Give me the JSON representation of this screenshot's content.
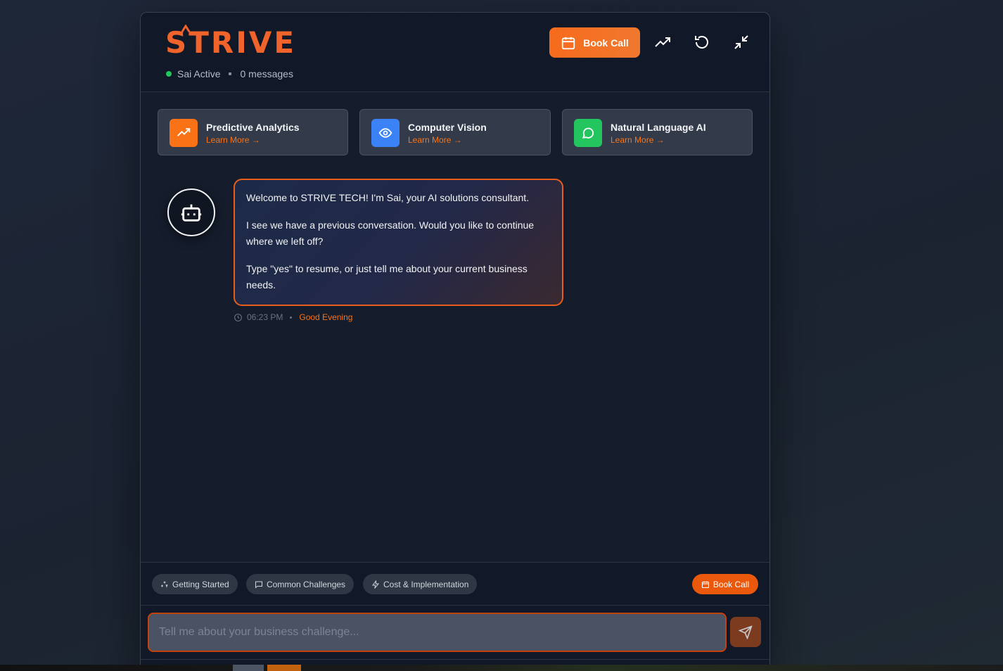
{
  "header": {
    "logo_text": "STRIVE",
    "status_label": "Sai Active",
    "message_count": "0 messages",
    "book_call_label": "Book Call",
    "brand_color": "#f76b1c"
  },
  "services": [
    {
      "title": "Predictive Analytics",
      "link": "Learn More →",
      "icon": "trending-up-icon",
      "color": "#f97316"
    },
    {
      "title": "Computer Vision",
      "link": "Learn More →",
      "icon": "eye-icon",
      "color": "#3b82f6"
    },
    {
      "title": "Natural Language AI",
      "link": "Learn More →",
      "icon": "chat-icon",
      "color": "#22c55e"
    }
  ],
  "message": {
    "paragraphs": [
      "Welcome to STRIVE TECH! I'm Sai, your AI solutions consultant.",
      "I see we have a previous conversation. Would you like to continue where we left off?",
      "Type \"yes\" to resume, or just tell me about your current business needs."
    ],
    "time": "06:23 PM",
    "greeting": "Good Evening"
  },
  "quick_actions": {
    "chips": [
      "Getting Started",
      "Common Challenges",
      "Cost & Implementation"
    ],
    "book_call_label": "Book Call"
  },
  "input": {
    "placeholder": "Tell me about your business challenge...",
    "value": ""
  }
}
